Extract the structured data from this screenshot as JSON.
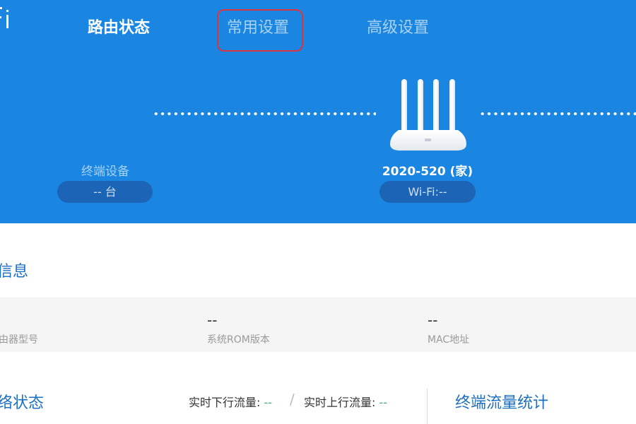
{
  "nav": {
    "tabs": [
      {
        "label": "路由状态",
        "active": true
      },
      {
        "label": "常用设置",
        "active": false
      },
      {
        "label": "高级设置",
        "active": false
      }
    ]
  },
  "topology": {
    "devices_label": "终端设备",
    "devices_count": "-- 台",
    "router_name": "2020-520 (家)",
    "wifi_status": "Wi-Fi:--"
  },
  "info": {
    "title": "信息",
    "fields": [
      {
        "label": "由器型号",
        "value": ""
      },
      {
        "label": "系统ROM版本",
        "value": "--"
      },
      {
        "label": "MAC地址",
        "value": "--"
      }
    ]
  },
  "network": {
    "title": "络状态",
    "down_label": "实时下行流量:",
    "down_value": "--",
    "separator": "/",
    "up_label": "实时上行流量:",
    "up_value": "--",
    "stats_title": "终端流量统计"
  },
  "colors": {
    "header_bg": "#1a86e2",
    "pill_bg": "#1b64b6",
    "highlight_border": "#d9343f",
    "section_title": "#1d6fc1",
    "traffic_value": "#3cb371"
  },
  "icons": {
    "router": "router-icon",
    "logo": "wifi-logo-fragment"
  }
}
